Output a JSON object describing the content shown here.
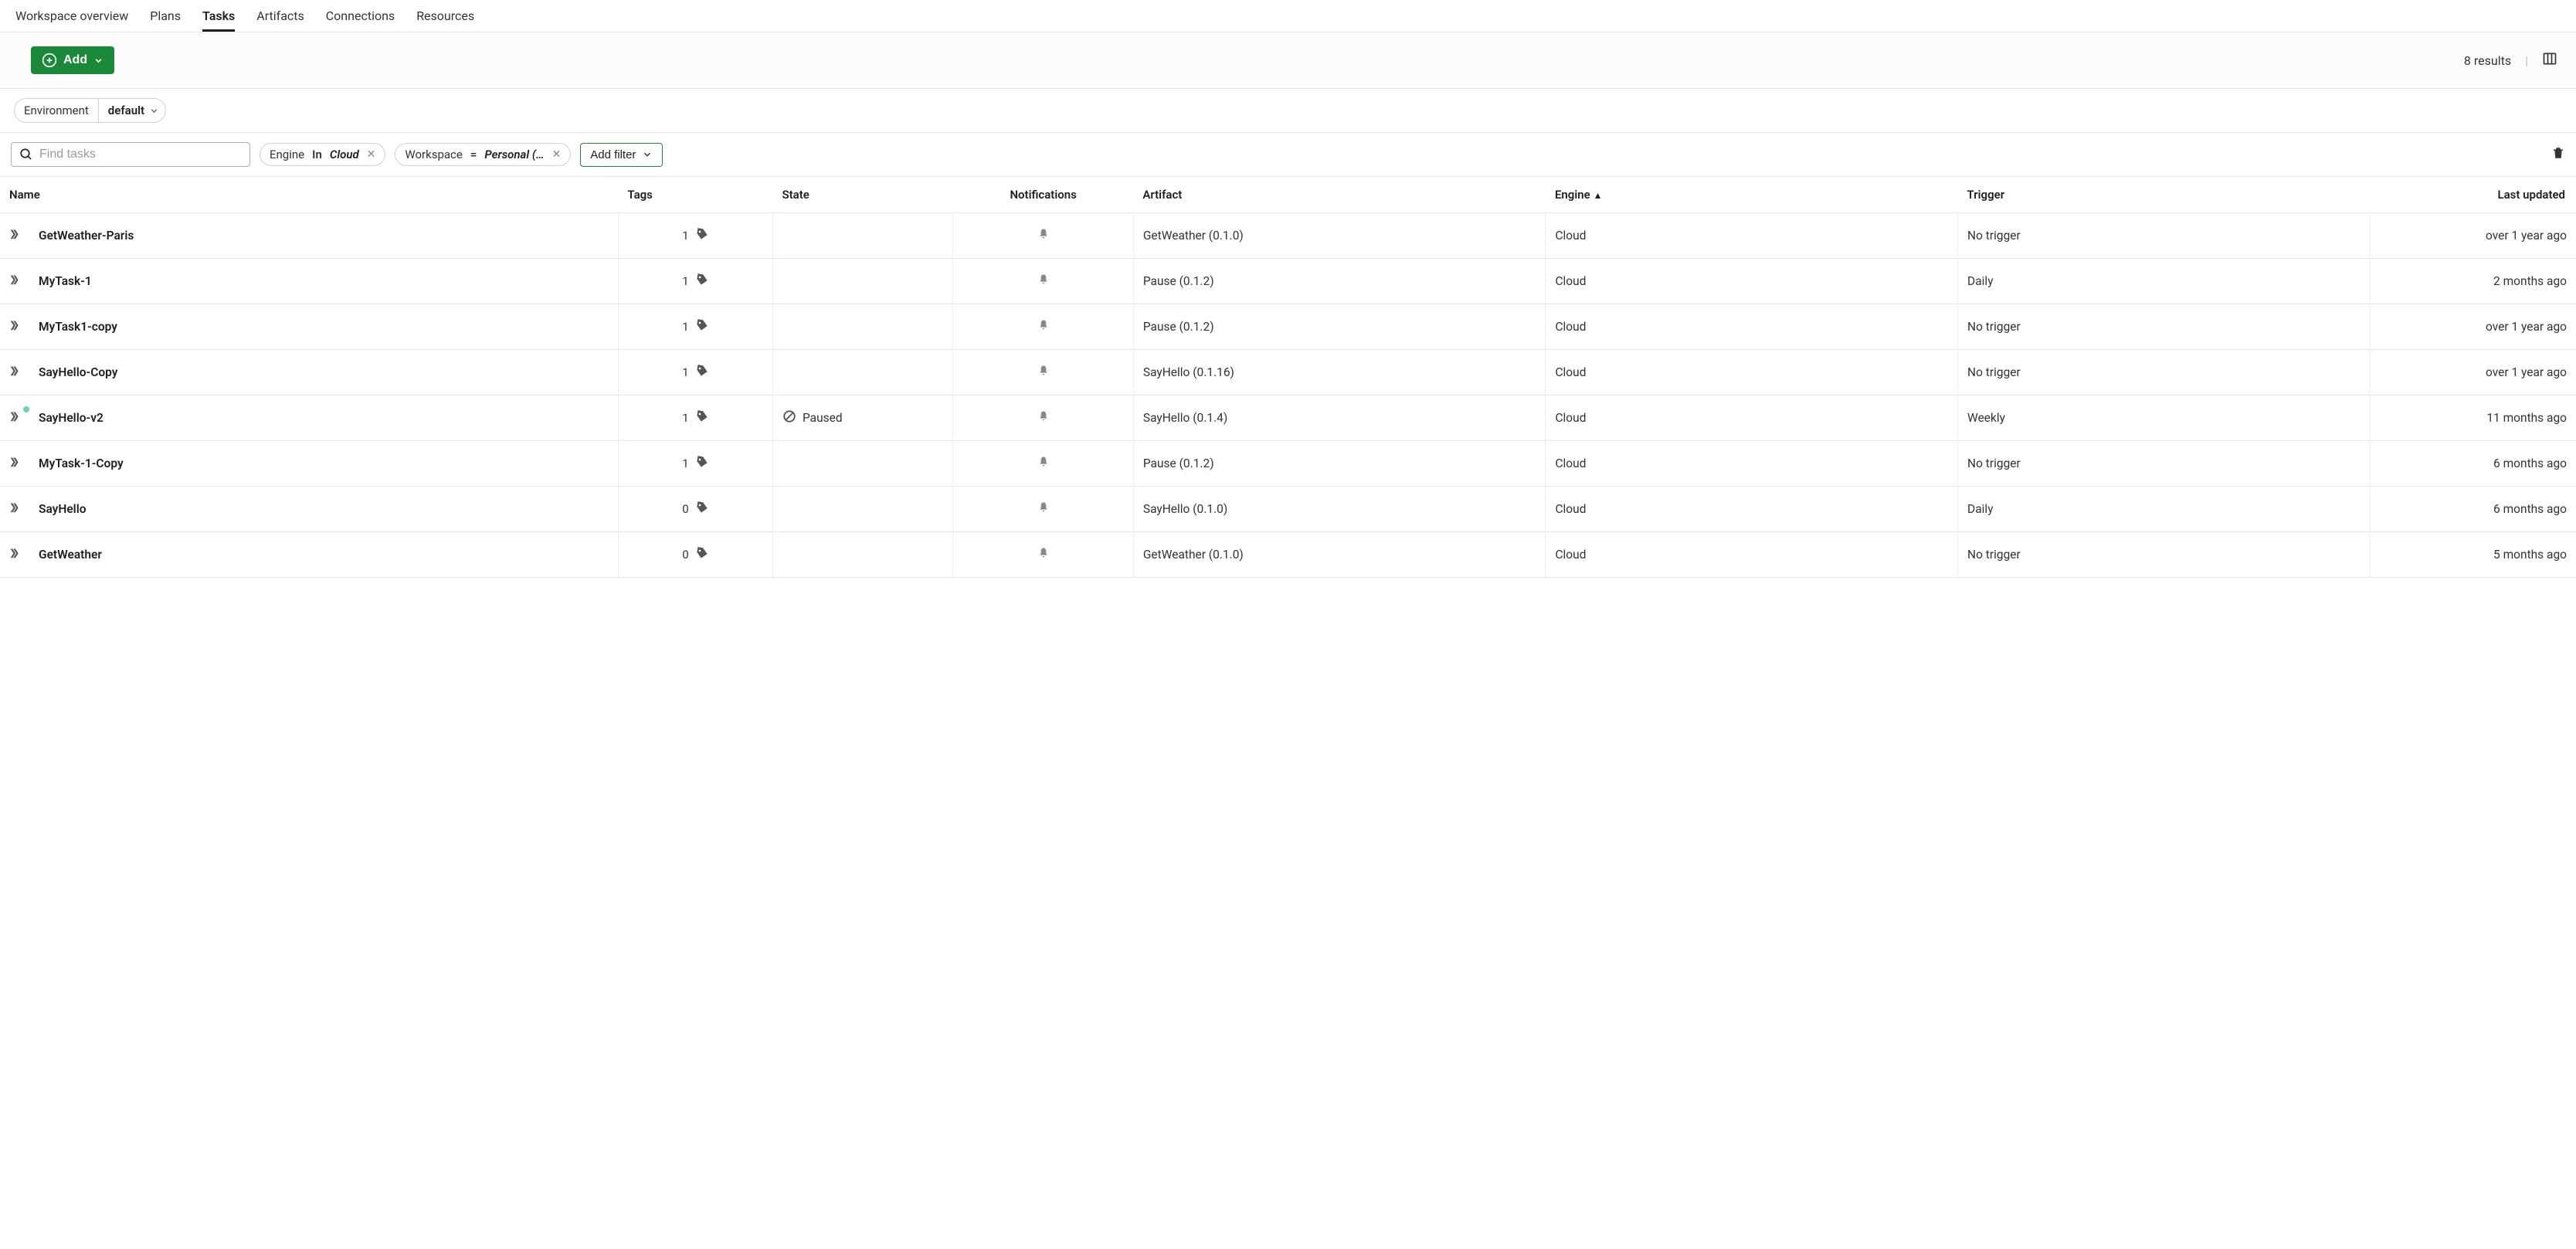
{
  "tabs": [
    {
      "label": "Workspace overview",
      "active": false
    },
    {
      "label": "Plans",
      "active": false
    },
    {
      "label": "Tasks",
      "active": true
    },
    {
      "label": "Artifacts",
      "active": false
    },
    {
      "label": "Connections",
      "active": false
    },
    {
      "label": "Resources",
      "active": false
    }
  ],
  "toolbar": {
    "add_label": "Add",
    "results_text": "8 results"
  },
  "environment": {
    "label": "Environment",
    "value": "default"
  },
  "search": {
    "placeholder": "Find tasks"
  },
  "filters": [
    {
      "key": "Engine",
      "op": "In",
      "value": "Cloud"
    },
    {
      "key": "Workspace",
      "op": "=",
      "value": "Personal (…"
    }
  ],
  "add_filter_label": "Add filter",
  "columns": {
    "name": "Name",
    "tags": "Tags",
    "state": "State",
    "notifications": "Notifications",
    "artifact": "Artifact",
    "engine": "Engine",
    "trigger": "Trigger",
    "last_updated": "Last updated"
  },
  "sort": {
    "column": "engine",
    "dir": "asc"
  },
  "rows": [
    {
      "name": "GetWeather-Paris",
      "tags": 1,
      "state": "",
      "artifact": "GetWeather (0.1.0)",
      "engine": "Cloud",
      "trigger": "No trigger",
      "updated": "over 1 year ago",
      "dot": false
    },
    {
      "name": "MyTask-1",
      "tags": 1,
      "state": "",
      "artifact": "Pause (0.1.2)",
      "engine": "Cloud",
      "trigger": "Daily",
      "updated": "2 months ago",
      "dot": false
    },
    {
      "name": "MyTask1-copy",
      "tags": 1,
      "state": "",
      "artifact": "Pause (0.1.2)",
      "engine": "Cloud",
      "trigger": "No trigger",
      "updated": "over 1 year ago",
      "dot": false
    },
    {
      "name": "SayHello-Copy",
      "tags": 1,
      "state": "",
      "artifact": "SayHello (0.1.16)",
      "engine": "Cloud",
      "trigger": "No trigger",
      "updated": "over 1 year ago",
      "dot": false
    },
    {
      "name": "SayHello-v2",
      "tags": 1,
      "state": "Paused",
      "artifact": "SayHello (0.1.4)",
      "engine": "Cloud",
      "trigger": "Weekly",
      "updated": "11 months ago",
      "dot": true
    },
    {
      "name": "MyTask-1-Copy",
      "tags": 1,
      "state": "",
      "artifact": "Pause (0.1.2)",
      "engine": "Cloud",
      "trigger": "No trigger",
      "updated": "6 months ago",
      "dot": false
    },
    {
      "name": "SayHello",
      "tags": 0,
      "state": "",
      "artifact": "SayHello (0.1.0)",
      "engine": "Cloud",
      "trigger": "Daily",
      "updated": "6 months ago",
      "dot": false
    },
    {
      "name": "GetWeather",
      "tags": 0,
      "state": "",
      "artifact": "GetWeather (0.1.0)",
      "engine": "Cloud",
      "trigger": "No trigger",
      "updated": "5 months ago",
      "dot": false
    }
  ]
}
